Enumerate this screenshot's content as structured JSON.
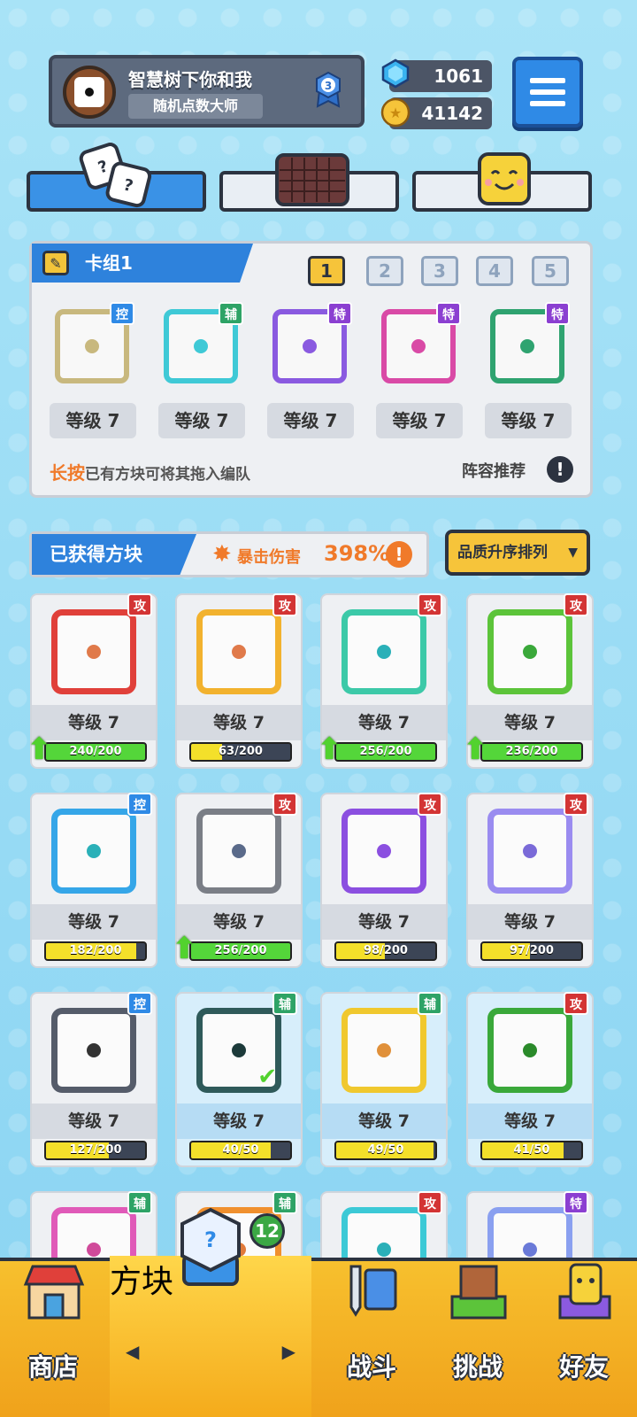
{
  "profile": {
    "nickname": "智慧树下你和我",
    "title": "随机点数大师",
    "rank": "3"
  },
  "currency": {
    "gems": "1061",
    "coins": "41142"
  },
  "deck": {
    "name": "卡组1",
    "numbers": [
      "1",
      "2",
      "3",
      "4",
      "5"
    ],
    "slots": [
      {
        "tag": "控",
        "level": "等级 7",
        "color": "#c8b87e"
      },
      {
        "tag": "辅",
        "level": "等级 7",
        "color": "#3fc9d6"
      },
      {
        "tag": "特",
        "level": "等级 7",
        "color": "#8a5ae0"
      },
      {
        "tag": "特",
        "level": "等级 7",
        "color": "#d94aa6"
      },
      {
        "tag": "特",
        "level": "等级 7",
        "color": "#2fa370"
      }
    ],
    "tip_highlight": "长按",
    "tip_text": "已有方块可将其拖入编队",
    "recommend": "阵容推荐"
  },
  "obtained": {
    "label": "已获得方块",
    "crit_label": "暴击伤害",
    "crit_value": "398%",
    "sort_label": "品质升序排列"
  },
  "cards": [
    {
      "tag": "攻",
      "level": "等级 7",
      "progress": "240/200",
      "ratio": 1.0,
      "upgrade": true,
      "color": "#e0403a",
      "dot": "#e07a4a",
      "fill": "#54d63a"
    },
    {
      "tag": "攻",
      "level": "等级 7",
      "progress": "63/200",
      "ratio": 0.315,
      "upgrade": false,
      "color": "#f2b22e",
      "dot": "#e07a4a",
      "fill": "#f4e02a"
    },
    {
      "tag": "攻",
      "level": "等级 7",
      "progress": "256/200",
      "ratio": 1.0,
      "upgrade": true,
      "color": "#3cc9a8",
      "dot": "#2ab0b8",
      "fill": "#54d63a"
    },
    {
      "tag": "攻",
      "level": "等级 7",
      "progress": "236/200",
      "ratio": 1.0,
      "upgrade": true,
      "color": "#5cc43a",
      "dot": "#3aa83a",
      "fill": "#54d63a"
    },
    {
      "tag": "控",
      "level": "等级 7",
      "progress": "182/200",
      "ratio": 0.91,
      "upgrade": false,
      "color": "#35a6e8",
      "dot": "#2ab0b8",
      "fill": "#f4e02a"
    },
    {
      "tag": "攻",
      "level": "等级 7",
      "progress": "256/200",
      "ratio": 1.0,
      "upgrade": true,
      "color": "#7a7e86",
      "dot": "#5a6a8a",
      "fill": "#54d63a"
    },
    {
      "tag": "攻",
      "level": "等级 7",
      "progress": "98/200",
      "ratio": 0.49,
      "upgrade": false,
      "color": "#8b4fe0",
      "dot": "#8b4fe0",
      "fill": "#f4e02a"
    },
    {
      "tag": "攻",
      "level": "等级 7",
      "progress": "97/200",
      "ratio": 0.485,
      "upgrade": false,
      "color": "#9a8cf0",
      "dot": "#7a6ad8",
      "fill": "#f4e02a"
    },
    {
      "tag": "控",
      "level": "等级 7",
      "progress": "127/200",
      "ratio": 0.635,
      "upgrade": false,
      "color": "#555c6a",
      "dot": "#333",
      "fill": "#f4e02a"
    },
    {
      "tag": "辅",
      "level": "等级 7",
      "progress": "40/50",
      "ratio": 0.8,
      "upgrade": false,
      "color": "#2f5a5a",
      "dot": "#1c3a3a",
      "fill": "#f4e02a",
      "highlight": true,
      "equipped": true
    },
    {
      "tag": "辅",
      "level": "等级 7",
      "progress": "49/50",
      "ratio": 0.98,
      "upgrade": false,
      "color": "#f0c82e",
      "dot": "#e0903a",
      "fill": "#f4e02a",
      "highlight": true
    },
    {
      "tag": "攻",
      "level": "等级 7",
      "progress": "41/50",
      "ratio": 0.82,
      "upgrade": false,
      "color": "#3aa83a",
      "dot": "#2a8a2a",
      "fill": "#f4e02a",
      "highlight": true
    },
    {
      "tag": "辅",
      "color": "#e05ab8",
      "dot": "#d04a9a"
    },
    {
      "tag": "辅",
      "color": "#f0902e",
      "dot": "#e07a3a"
    },
    {
      "tag": "攻",
      "color": "#3cc9d6",
      "dot": "#2ab0b8"
    },
    {
      "tag": "特",
      "color": "#8aa0f0",
      "dot": "#6a7ad8"
    }
  ],
  "nav": {
    "shop": "商店",
    "blocks": "方块",
    "battle": "战斗",
    "challenge": "挑战",
    "friends": "好友",
    "blocks_badge": "12"
  }
}
